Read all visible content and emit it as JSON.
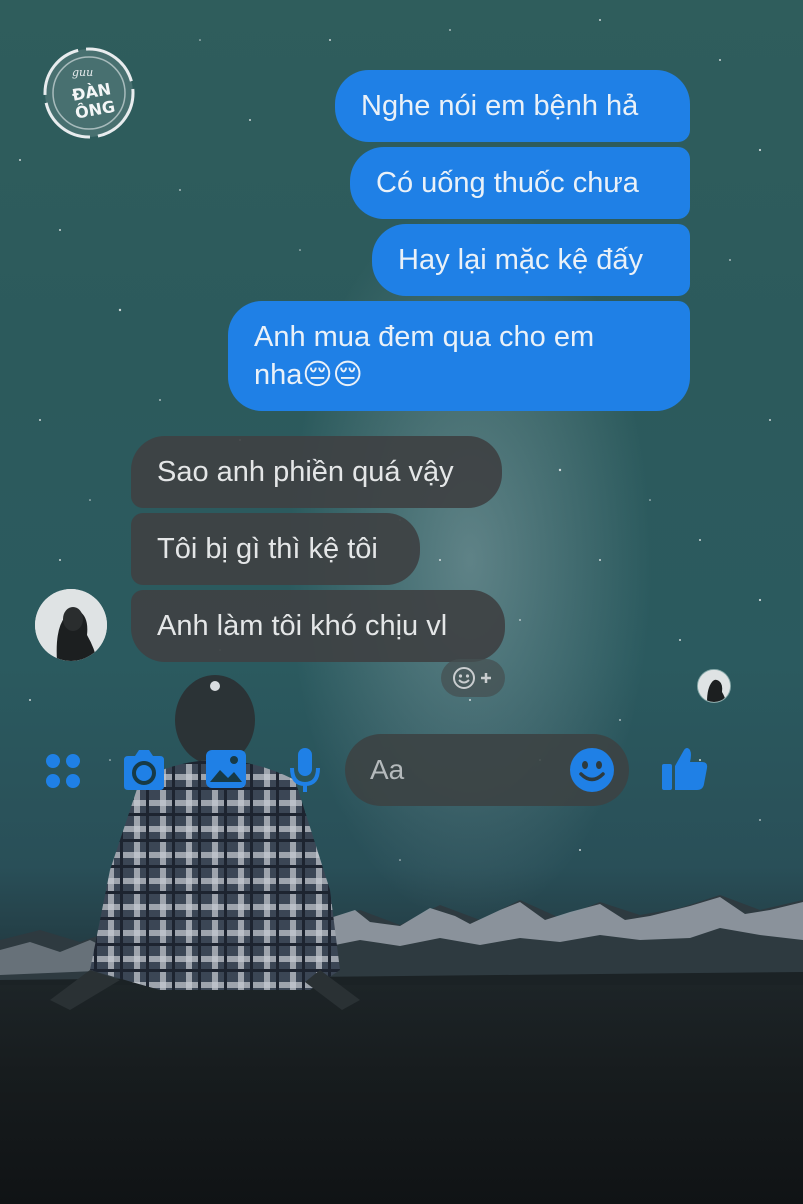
{
  "brand": {
    "logo_text_top": "guu",
    "logo_text_main_1": "ĐÀN",
    "logo_text_main_2": "ÔNG"
  },
  "messages": {
    "outgoing": [
      {
        "text": "Nghe nói em bệnh hả"
      },
      {
        "text": "Có uống thuốc chưa"
      },
      {
        "text": "Hay lại mặc kệ đấy"
      },
      {
        "text_line1": "Anh mua đem qua cho em",
        "text_line2": "nha😔😔"
      }
    ],
    "incoming": [
      {
        "text": "Sao anh phiền quá vậy"
      },
      {
        "text": "Tôi bị gì thì kệ tôi"
      },
      {
        "text": "Anh làm tôi khó chịu vl"
      }
    ]
  },
  "composer": {
    "placeholder": "Aa"
  },
  "icons": {
    "menu": "four-dots-icon",
    "camera": "camera-icon",
    "gallery": "image-icon",
    "mic": "microphone-icon",
    "emoji": "smiley-icon",
    "like": "thumbs-up-icon",
    "react": "add-reaction-icon"
  },
  "colors": {
    "accent": "#1f80e6",
    "outgoing_bubble": "#1f80e6",
    "incoming_bubble": "#3e4244"
  }
}
